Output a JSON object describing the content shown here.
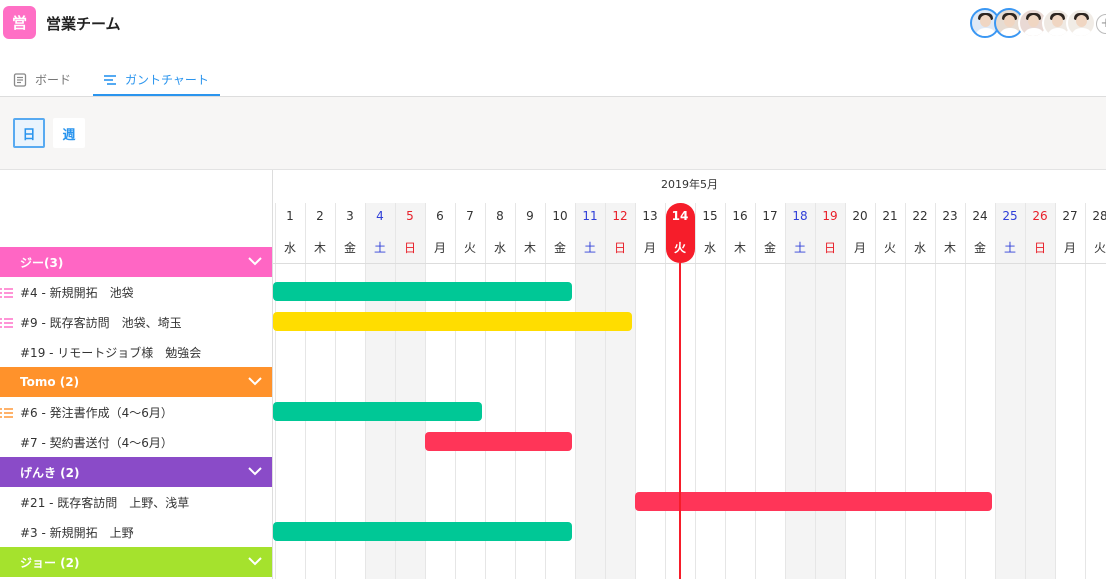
{
  "app": {
    "icon_char": "営",
    "icon_color": "#ff6fc5",
    "title": "営業チーム"
  },
  "avatars": [
    "user-1",
    "user-2",
    "user-3",
    "user-4",
    "user-5"
  ],
  "avatar_add": "+",
  "tabs": [
    {
      "label": "ボード",
      "icon": "document-icon",
      "active": false
    },
    {
      "label": "ガントチャート",
      "icon": "gantt-icon",
      "active": true
    }
  ],
  "scale": {
    "day": "日",
    "week": "週",
    "selected": "day"
  },
  "timeline": {
    "month_label": "2019年5月",
    "today_day": 14,
    "days": [
      {
        "n": "1",
        "w": "水"
      },
      {
        "n": "2",
        "w": "木"
      },
      {
        "n": "3",
        "w": "金"
      },
      {
        "n": "4",
        "w": "土"
      },
      {
        "n": "5",
        "w": "日"
      },
      {
        "n": "6",
        "w": "月"
      },
      {
        "n": "7",
        "w": "火"
      },
      {
        "n": "8",
        "w": "水"
      },
      {
        "n": "9",
        "w": "木"
      },
      {
        "n": "10",
        "w": "金"
      },
      {
        "n": "11",
        "w": "土"
      },
      {
        "n": "12",
        "w": "日"
      },
      {
        "n": "13",
        "w": "月"
      },
      {
        "n": "14",
        "w": "火"
      },
      {
        "n": "15",
        "w": "水"
      },
      {
        "n": "16",
        "w": "木"
      },
      {
        "n": "17",
        "w": "金"
      },
      {
        "n": "18",
        "w": "土"
      },
      {
        "n": "19",
        "w": "日"
      },
      {
        "n": "20",
        "w": "月"
      },
      {
        "n": "21",
        "w": "火"
      },
      {
        "n": "22",
        "w": "水"
      },
      {
        "n": "23",
        "w": "木"
      },
      {
        "n": "24",
        "w": "金"
      },
      {
        "n": "25",
        "w": "土"
      },
      {
        "n": "26",
        "w": "日"
      },
      {
        "n": "27",
        "w": "月"
      },
      {
        "n": "28",
        "w": "火"
      }
    ]
  },
  "groups": [
    {
      "label": "ジー(3)",
      "color": "#ff66c4",
      "tasks": [
        {
          "label": "#4 - 新規開拓　池袋",
          "has_subtasks": true,
          "start": 1,
          "end": 10,
          "color": "#00c896"
        },
        {
          "label": "#9 - 既存客訪問　池袋、埼玉",
          "has_subtasks": true,
          "start": 1,
          "end": 12,
          "color": "#ffdd00"
        },
        {
          "label": "#19 - リモートジョブ様　勉強会",
          "has_subtasks": false,
          "start": null,
          "end": null,
          "color": null
        }
      ]
    },
    {
      "label": "Tomo (2)",
      "color": "#ff922b",
      "tasks": [
        {
          "label": "#6 - 発注書作成（4〜6月）",
          "has_subtasks": true,
          "start": 1,
          "end": 7,
          "color": "#00c896"
        },
        {
          "label": "#7 - 契約書送付（4〜6月）",
          "has_subtasks": false,
          "start": 6,
          "end": 10,
          "color": "#ff3558"
        }
      ]
    },
    {
      "label": "げんき (2)",
      "color": "#8a4bc8",
      "tasks": [
        {
          "label": "#21 - 既存客訪問　上野、浅草",
          "has_subtasks": false,
          "start": 13,
          "end": 24,
          "color": "#ff3558"
        },
        {
          "label": "#3 - 新規開拓　上野",
          "has_subtasks": false,
          "start": 1,
          "end": 10,
          "color": "#00c896"
        }
      ]
    },
    {
      "label": "ジョー (2)",
      "color": "#a5e22d",
      "tasks": []
    }
  ]
}
